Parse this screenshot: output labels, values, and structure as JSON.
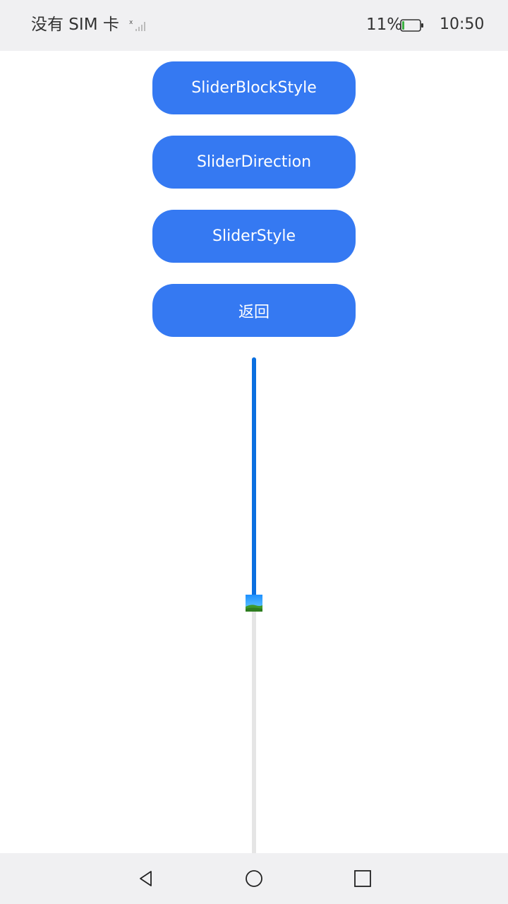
{
  "status_bar": {
    "carrier": "没有 SIM 卡",
    "battery_percent": "11%",
    "battery_level": 0.11,
    "time": "10:50",
    "signal_icon": "signal-no-sim-icon",
    "battery_icon": "battery-icon"
  },
  "buttons": [
    {
      "label": "SliderBlockStyle"
    },
    {
      "label": "SliderDirection"
    },
    {
      "label": "SliderStyle"
    },
    {
      "label": "返回"
    }
  ],
  "slider": {
    "direction": "vertical",
    "value_fraction": 0.45,
    "thumb_icon": "image-thumb-icon",
    "colors": {
      "fill": "#0a6fe0",
      "track": "#e5e5e5"
    }
  },
  "nav_bar": {
    "icons": [
      "back-triangle-icon",
      "home-circle-icon",
      "recent-square-icon"
    ]
  },
  "colors": {
    "button": "#3579f2",
    "button_text": "#ffffff",
    "bars": "#f0f0f2"
  }
}
